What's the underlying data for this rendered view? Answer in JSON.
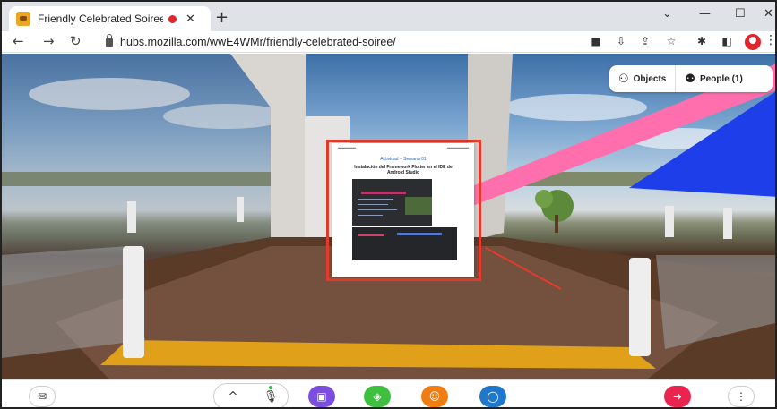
{
  "browser": {
    "tab_title": "Friendly Celebrated Soiree | ",
    "tab_close_glyph": "✕",
    "new_tab_glyph": "+",
    "window_controls": {
      "chevron": "⌄",
      "minimize": "—",
      "maximize": "☐",
      "close": "✕"
    },
    "nav": {
      "back": "←",
      "forward": "→",
      "reload": "↻"
    },
    "url": "hubs.mozilla.com/wwE4WMr/friendly-celebrated-soiree/",
    "toolbar_icons": [
      "camera-icon",
      "install-icon",
      "share-icon",
      "star-icon",
      "extensions-icon",
      "sidepanel-icon",
      "profile-icon",
      "menu-icon"
    ],
    "menu_glyph": "⋮"
  },
  "hubs": {
    "objects_label": "Objects",
    "people_label": "People (1)",
    "document": {
      "subtitle": "Actividad – Semana 01",
      "heading": "Instalación del Framework Flutter en el IDE de Android Studio"
    }
  },
  "bottom_bar": {
    "chat_glyph": "✉",
    "chevron_glyph": "^",
    "mic_glyph": "🎙",
    "share_glyph": "▣",
    "place_glyph": "◈",
    "react_glyph": "☺",
    "chat2_glyph": "◯",
    "leave_glyph": "➜",
    "more_glyph": "⋮"
  },
  "colors": {
    "frame_highlight": "#e53a2b",
    "btn_share": "#7b4de0",
    "btn_place": "#3fbf3f",
    "btn_react": "#f07d12",
    "btn_chat": "#1f78c9",
    "btn_leave": "#e8244f"
  }
}
